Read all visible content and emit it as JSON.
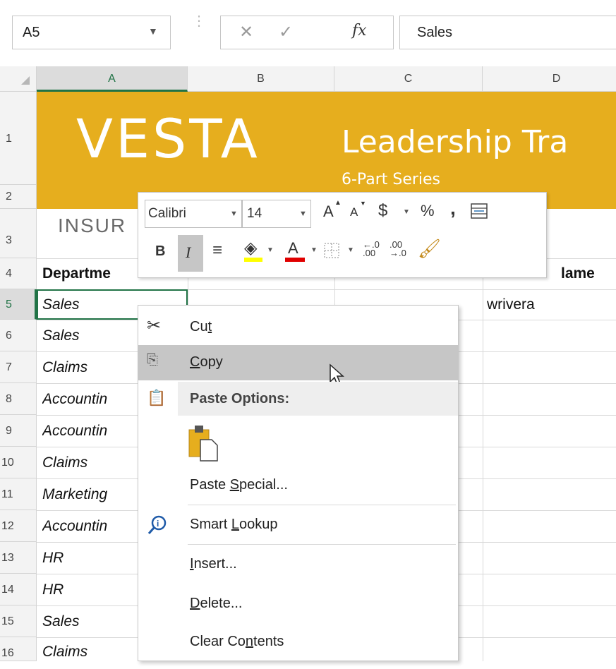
{
  "formula_bar": {
    "name_box": "A5",
    "formula": "Sales"
  },
  "columns": [
    "A",
    "B",
    "C",
    "D"
  ],
  "rows": [
    "1",
    "2",
    "3",
    "4",
    "5",
    "6",
    "7",
    "8",
    "9",
    "10",
    "11",
    "12",
    "13",
    "14",
    "15",
    "16"
  ],
  "banner": {
    "logo": "VESTA",
    "title": "Leadership Tra",
    "subtitle": "6-Part Series",
    "insur": "INSUR"
  },
  "headers": {
    "a4": "Departme",
    "d4": "lame"
  },
  "cells": {
    "d5": "wrivera",
    "departments": [
      "Sales",
      "Sales",
      "Claims",
      "Accountin",
      "Accountin",
      "Claims",
      "Marketing",
      "Accountin",
      "HR",
      "HR",
      "Sales",
      "Claims"
    ]
  },
  "mini_toolbar": {
    "font": "Calibri",
    "size": "14",
    "grow_font": "A",
    "shrink_font": "A",
    "currency": "$",
    "percent": "%",
    "comma": ",",
    "bold": "B",
    "italic": "I",
    "font_color": "A"
  },
  "context_menu": {
    "cut_pre": "Cu",
    "cut_ul": "t",
    "cut_post": "",
    "copy_pre": "",
    "copy_ul": "C",
    "copy_post": "opy",
    "paste_options": "Paste Options:",
    "paste_special_pre": "Paste ",
    "paste_special_ul": "S",
    "paste_special_post": "pecial...",
    "smart_lookup_pre": "Smart ",
    "smart_lookup_ul": "L",
    "smart_lookup_post": "ookup",
    "insert_pre": "",
    "insert_ul": "I",
    "insert_post": "nsert...",
    "delete_pre": "",
    "delete_ul": "D",
    "delete_post": "elete...",
    "clear_pre": "Clear Co",
    "clear_ul": "n",
    "clear_post": "tents"
  },
  "colors": {
    "banner": "#e6ae1e",
    "accent_green": "#217346",
    "highlight": "#c6c6c6"
  }
}
